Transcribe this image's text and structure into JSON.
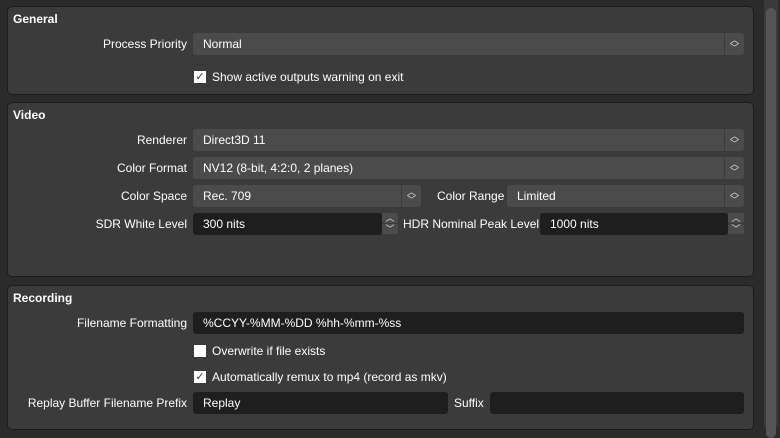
{
  "general": {
    "title": "General",
    "process_priority_label": "Process Priority",
    "process_priority_value": "Normal",
    "show_warning_label": "Show active outputs warning on exit",
    "show_warning_checked": true
  },
  "video": {
    "title": "Video",
    "renderer_label": "Renderer",
    "renderer_value": "Direct3D 11",
    "color_format_label": "Color Format",
    "color_format_value": "NV12 (8-bit, 4:2:0, 2 planes)",
    "color_space_label": "Color Space",
    "color_space_value": "Rec. 709",
    "color_range_label": "Color Range",
    "color_range_value": "Limited",
    "sdr_label": "SDR White Level",
    "sdr_value": "300 nits",
    "hdr_label": "HDR Nominal Peak Level",
    "hdr_value": "1000 nits"
  },
  "recording": {
    "title": "Recording",
    "filename_label": "Filename Formatting",
    "filename_value": "%CCYY-%MM-%DD %hh-%mm-%ss",
    "overwrite_label": "Overwrite if file exists",
    "overwrite_checked": false,
    "remux_label": "Automatically remux to mp4 (record as mkv)",
    "remux_checked": true,
    "prefix_label": "Replay Buffer Filename Prefix",
    "prefix_value": "Replay",
    "suffix_label": "Suffix",
    "suffix_value": ""
  },
  "icons": {
    "check": "✓",
    "updown": "⌃⌄",
    "up": "⌃",
    "down": "⌄"
  }
}
